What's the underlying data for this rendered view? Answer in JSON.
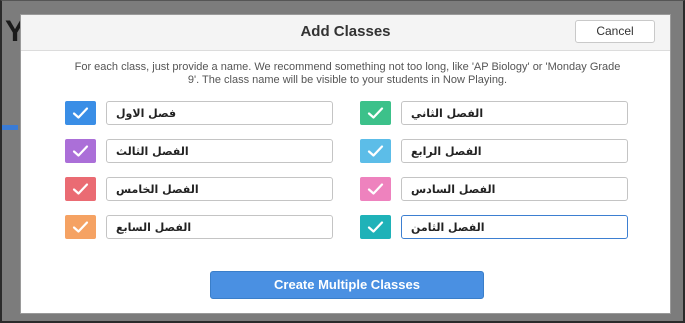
{
  "background": {
    "partial_letter": "Y"
  },
  "modal": {
    "title": "Add Classes",
    "cancel_label": "Cancel",
    "description": "For each class, just provide a name. We recommend something not too long, like 'AP Biology' or 'Monday Grade 9'. The class name will be visible to your students in Now Playing.",
    "create_label": "Create Multiple Classes"
  },
  "classes": [
    {
      "name": "فصل الاول",
      "color": "#3a8ee6"
    },
    {
      "name": "الفصل الثاني",
      "color": "#3cc18a"
    },
    {
      "name": "الفصل الثالث",
      "color": "#ab6fd8"
    },
    {
      "name": "الفصل الرابع",
      "color": "#5cbde8"
    },
    {
      "name": "الفصل الخامس",
      "color": "#ea6b73"
    },
    {
      "name": "الفصل السادس",
      "color": "#ee82be"
    },
    {
      "name": "الفصل السابع",
      "color": "#f5a263"
    },
    {
      "name": "الفصل الثامن",
      "color": "#1fb2b8"
    }
  ],
  "icons": {
    "checkbox": "check-icon"
  }
}
